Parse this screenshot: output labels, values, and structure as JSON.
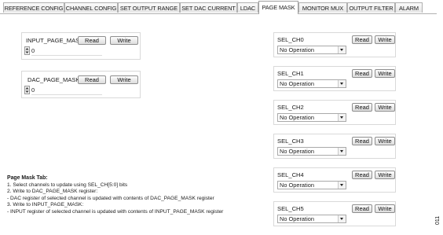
{
  "tabs": [
    {
      "label": "REFERENCE CONFIG",
      "active": false
    },
    {
      "label": "CHANNEL CONFIG",
      "active": false
    },
    {
      "label": "SET OUTPUT RANGE",
      "active": false
    },
    {
      "label": "SET DAC CURRENT",
      "active": false
    },
    {
      "label": "LDAC",
      "active": false
    },
    {
      "label": "PAGE MASK",
      "active": true
    },
    {
      "label": "MONITOR MUX",
      "active": false
    },
    {
      "label": "OUTPUT FILTER",
      "active": false
    },
    {
      "label": "ALARM",
      "active": false
    }
  ],
  "input_page_mask": {
    "label": "INPUT_PAGE_MASK",
    "read": "Read",
    "write": "Write",
    "value": "0"
  },
  "dac_page_mask": {
    "label": "DAC_PAGE_MASK",
    "read": "Read",
    "write": "Write",
    "value": "0"
  },
  "channels": [
    {
      "label": "SEL_CH0",
      "read": "Read",
      "write": "Write",
      "selected": "No Operation"
    },
    {
      "label": "SEL_CH1",
      "read": "Read",
      "write": "Write",
      "selected": "No Operation"
    },
    {
      "label": "SEL_CH2",
      "read": "Read",
      "write": "Write",
      "selected": "No Operation"
    },
    {
      "label": "SEL_CH3",
      "read": "Read",
      "write": "Write",
      "selected": "No Operation"
    },
    {
      "label": "SEL_CH4",
      "read": "Read",
      "write": "Write",
      "selected": "No Operation"
    },
    {
      "label": "SEL_CH5",
      "read": "Read",
      "write": "Write",
      "selected": "No Operation"
    }
  ],
  "instructions": {
    "heading": "Page Mask Tab:",
    "lines": [
      "1. Select channels to update using SEL_CH[5:0] bits",
      "2. Write to DAC_PAGE_MASK register:",
      " - DAC register of selected channel is updated with contents of DAC_PAGE_MASK register",
      "3. Write to INPUT_PAGE_MASK:",
      " - INPUT register of selected channel is updated with contents of INPUT_PAGE_MASK register"
    ]
  },
  "side_code": "011",
  "icons": {
    "spinner": "spinner-updown-icon",
    "dropdown": "chevron-down-icon"
  }
}
